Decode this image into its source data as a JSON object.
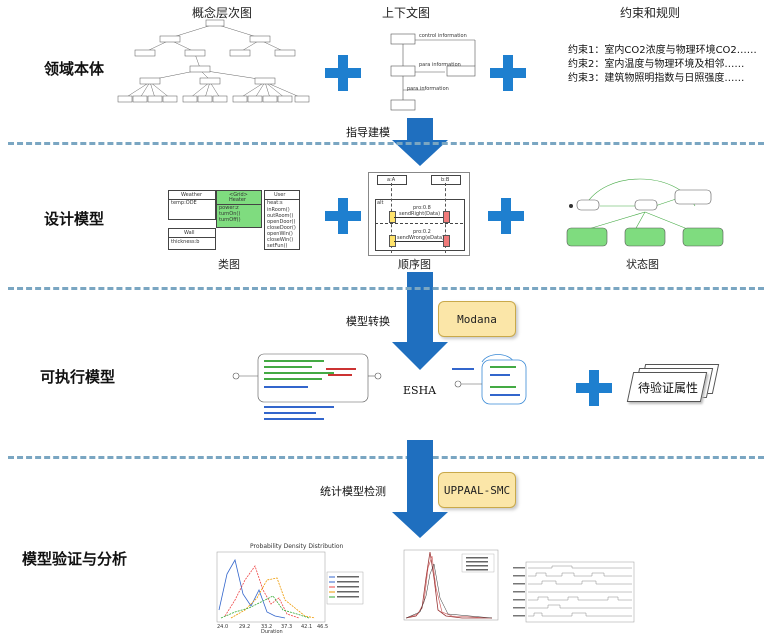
{
  "headers": {
    "concept": "概念层次图",
    "context": "上下文图",
    "constraints": "约束和规则"
  },
  "rows": {
    "domain": "领域本体",
    "design": "设计模型",
    "executable": "可执行模型",
    "verify": "模型验证与分析"
  },
  "arrows": {
    "guide": "指导建模",
    "transform": "模型转换",
    "smc": "统计模型检测"
  },
  "tools": {
    "modana": "Modana",
    "uppaal": "UPPAAL-SMC"
  },
  "constraints": [
    "约束1：室内CO2浓度与物理环境CO2……",
    "约束2：室内温度与物理环境及相邻……",
    "约束3：建筑物照明指数与日照强度……"
  ],
  "context_diagram": {
    "top_label": "control information",
    "mid_label": "para information",
    "bottom_label": "para information"
  },
  "design_captions": {
    "class": "类图",
    "sequence": "顺序图",
    "state": "状态图"
  },
  "class_diagram": {
    "weather": {
      "name": "Weather",
      "attr": "temp:ODE"
    },
    "heater": {
      "stereo": "<Grid>",
      "name": "Heater",
      "attr": "power:z",
      "ops": [
        "turnOn()",
        "turnOff()"
      ]
    },
    "user": {
      "name": "User",
      "attr": "heat:s",
      "ops": [
        "inRoom()",
        "outRoom()",
        "openDoor()",
        "closeDoor()",
        "openWin()",
        "closeWin()",
        "setFun()"
      ]
    },
    "wall": {
      "name": "Wall",
      "attr": "thickness:b"
    }
  },
  "sequence_diagram": {
    "a": "a:A",
    "b": "b:B",
    "alt": "alt",
    "msg1_prob": "pro:0.8",
    "msg1": "sendRight(Data)",
    "msg2_prob": "pro:0.2",
    "msg2": "sendWrong(eData)"
  },
  "executable": {
    "esha": "ESHA",
    "properties": "待验证属性"
  },
  "colors": {
    "accent": "#1e7fcf",
    "arrow": "#1f6fbf",
    "dash": "#7aa6c2",
    "tag_bg": "#fbe6a8",
    "green": "#7fdc7f"
  },
  "pdf_chart": {
    "title": "Probability Density Distribution",
    "xlabel": "Duration",
    "xticks": [
      "24.0",
      "29.2",
      "33.2",
      "37.3",
      "42.1",
      "46.5"
    ]
  }
}
